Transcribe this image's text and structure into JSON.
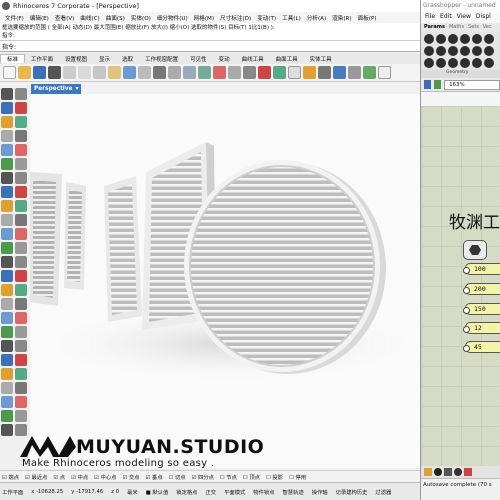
{
  "rhino": {
    "title": "Rhinoceros 7 Corporate - [Perspective]",
    "menu": [
      "文件(F)",
      "编辑(E)",
      "查看(V)",
      "曲线(C)",
      "曲面(S)",
      "实体(O)",
      "细分物件(U)",
      "网格(M)",
      "尺寸标注(D)",
      "变动(T)",
      "工具(L)",
      "分析(A)",
      "渲染(R)",
      "面板(P)"
    ],
    "command_history": [
      "框选要缩放的范围 ( 全部(A)  动态(D)  最大范围(E)  缩放比(F)  放大(I)  缩小(O)  选取的物件(S)  目标(T)  1比1(B) ):",
      "指令:"
    ],
    "command_prompt": "指令:",
    "tabs": [
      "标准",
      "工作平面",
      "设置视图",
      "显示",
      "选取",
      "工作视窗配置",
      "可见性",
      "变动",
      "曲线工具",
      "曲面工具",
      "实体工具"
    ],
    "active_tab": "标准",
    "viewport_label": "Perspective",
    "osnap": [
      "☑ 端点",
      "☑ 最近点",
      "☑ 点",
      "☑ 中点",
      "☑ 中心点",
      "☑ 交点",
      "☑ 垂点",
      "☐ 切点",
      "☑ 四分点",
      "☐ 节点",
      "☐ 顶点",
      "☐ 投影",
      "☐ 停用"
    ],
    "status": [
      "工作平面",
      "x -10628.25",
      "y -17917.46",
      "z 0",
      "毫米",
      "■ 默认值",
      "锁定格点",
      "正交",
      "平面模式",
      "物件锁点",
      "智慧轨迹",
      "操作轴",
      "记录建构历史",
      "过滤器"
    ]
  },
  "brand": {
    "title": "MUYUAN.STUDIO",
    "slogan": "Make Rhinoceros modeling so easy ."
  },
  "grasshopper": {
    "title": "Grasshopper - unnamed",
    "menu": [
      "File",
      "Edit",
      "View",
      "Displ"
    ],
    "tabs": [
      "Params",
      "Maths",
      "Sets",
      "Vec"
    ],
    "active_tab": "Params",
    "sub_label": "Geometry",
    "zoom": "163%",
    "canvas_title": "牧渊工",
    "sliders": [
      "100",
      "200",
      "150",
      "12",
      "45"
    ],
    "status": "Autosave complete (70 s"
  },
  "colors": {
    "viewport_tab": "#3b78c2",
    "slider": "#f4f4a8",
    "gh_canvas": "#d6dbc6"
  }
}
